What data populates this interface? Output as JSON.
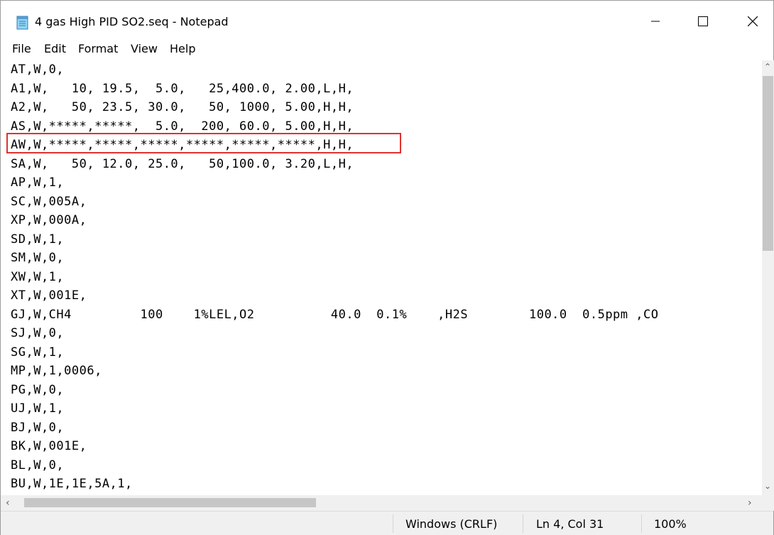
{
  "window": {
    "title": "4 gas High PID SO2.seq - Notepad",
    "icon": "notepad-icon"
  },
  "menu": [
    "File",
    "Edit",
    "Format",
    "View",
    "Help"
  ],
  "editor": {
    "lines": [
      "AT,W,0,",
      "A1,W,   10, 19.5,  5.0,   25,400.0, 2.00,L,H,",
      "A2,W,   50, 23.5, 30.0,   50, 1000, 5.00,H,H,",
      "AS,W,*****,*****,  5.0,  200, 60.0, 5.00,H,H,",
      "AW,W,*****,*****,*****,*****,*****,*****,H,H,",
      "SA,W,   50, 12.0, 25.0,   50,100.0, 3.20,L,H,",
      "AP,W,1,",
      "SC,W,005A,",
      "XP,W,000A,",
      "SD,W,1,",
      "SM,W,0,",
      "XW,W,1,",
      "XT,W,001E,",
      "GJ,W,CH4         100    1%LEL,O2          40.0  0.1%    ,H2S        100.0  0.5ppm ,CO",
      "SJ,W,0,",
      "SG,W,1,",
      "MP,W,1,0006,",
      "PG,W,0,",
      "UJ,W,1,",
      "BJ,W,0,",
      "BK,W,001E,",
      "BL,W,0,",
      "BU,W,1E,1E,5A,1,"
    ],
    "highlighted_line_index": 4,
    "highlight_color": "#e03131"
  },
  "statusbar": {
    "line_ending": "Windows (CRLF)",
    "position": "Ln 4, Col 31",
    "zoom": "100%"
  }
}
